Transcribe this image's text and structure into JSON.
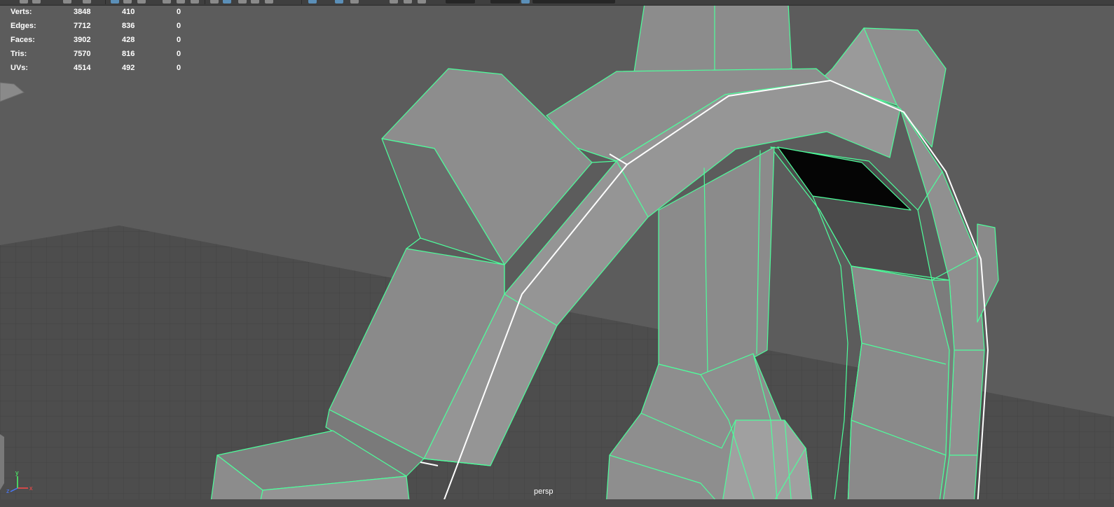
{
  "hud": {
    "rows": [
      {
        "label": "Verts:",
        "c1": "3848",
        "c2": "410",
        "c3": "0"
      },
      {
        "label": "Edges:",
        "c1": "7712",
        "c2": "836",
        "c3": "0"
      },
      {
        "label": "Faces:",
        "c1": "3902",
        "c2": "428",
        "c3": "0"
      },
      {
        "label": "Tris:",
        "c1": "7570",
        "c2": "816",
        "c3": "0"
      },
      {
        "label": "UVs:",
        "c1": "4514",
        "c2": "492",
        "c3": "0"
      }
    ]
  },
  "viewport": {
    "camera": "persp"
  },
  "axis": {
    "x_label": "x",
    "y_label": "y",
    "z_label": "z"
  },
  "colors": {
    "background": "#5b5b5b",
    "wireframe": "#4dff9c",
    "selected_edge": "#ffffff",
    "grid": "#4c4c4c",
    "toolbar": "#3f3f3f",
    "active_icon": "#5b8fb8"
  },
  "icons": [
    "select-tool-icon",
    "lasso-tool-icon",
    "paint-select-icon",
    "snap-grid-icon",
    "snap-curve-icon",
    "snap-point-icon",
    "camera-icon",
    "wireframe-icon",
    "shaded-icon",
    "xray-icon",
    "isolate-icon",
    "gamma-icon"
  ]
}
